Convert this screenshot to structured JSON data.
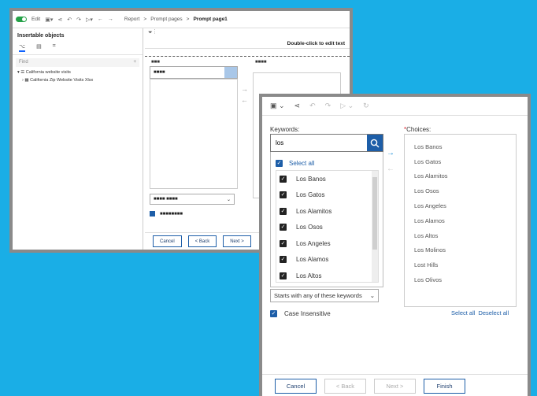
{
  "back_window": {
    "toolbar": {
      "edit_label": "Edit"
    },
    "breadcrumb": [
      "Report",
      "Prompt pages",
      "Prompt page1"
    ],
    "left_panel": {
      "title": "Insertable objects",
      "find_placeholder": "Find",
      "tree": [
        "California website visits",
        "California Zip Website Visits Xlsx"
      ]
    },
    "edit_hint": "Double-click to edit text",
    "search_value": "■■■■",
    "list_header": "■■■",
    "choices_header": "■■■■",
    "select_value": "■■■■ ■■■■",
    "checkbox_label": "■■■■■■■■",
    "buttons": {
      "cancel": "Cancel",
      "back": "< Back",
      "next": "Next >"
    }
  },
  "front_window": {
    "keywords_label": "Keywords:",
    "search_value": "los",
    "select_all_label": "Select all",
    "options": [
      "Los Banos",
      "Los Gatos",
      "Los Alamitos",
      "Los Osos",
      "Los Angeles",
      "Los Alamos",
      "Los Altos"
    ],
    "match_mode": "Starts with any of these keywords",
    "case_label": "Case Insensitive",
    "choices_label": "Choices:",
    "choices": [
      "Los Banos",
      "Los Gatos",
      "Los Alamitos",
      "Los Osos",
      "Los Angeles",
      "Los Alamos",
      "Los Altos",
      "Los Molinos",
      "Lost Hills",
      "Los Olivos"
    ],
    "select_all_link": "Select all",
    "deselect_all_link": "Deselect all",
    "buttons": {
      "cancel": "Cancel",
      "back": "< Back",
      "next": "Next >",
      "finish": "Finish"
    }
  },
  "colors": {
    "background": "#1aaee6",
    "accent": "#1d5ea8"
  }
}
